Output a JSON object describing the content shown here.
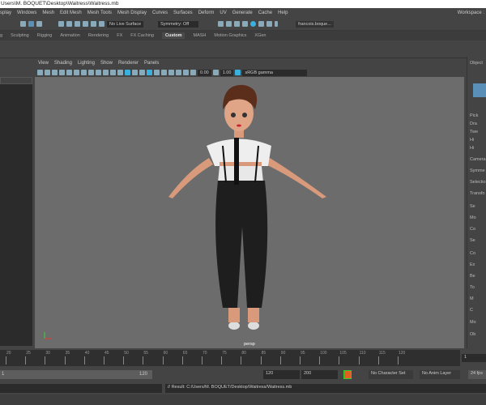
{
  "title": "Users\\M. BOQUET\\Desktop\\Waitress\\Waitress.mb",
  "menu": [
    "splay",
    "Windows",
    "Mesh",
    "Edit Mesh",
    "Mesh Tools",
    "Mesh Display",
    "Curves",
    "Surfaces",
    "Deform",
    "UV",
    "Generate",
    "Cache",
    "Help"
  ],
  "workspace": "Workspace :",
  "shelfbar": {
    "live_surface": "No Live Surface",
    "symmetry": "Symmetry: Off",
    "user": "francois.boque..."
  },
  "tabs": [
    "g",
    "Sculpting",
    "Rigging",
    "Animation",
    "Rendering",
    "FX",
    "FX Caching",
    "Custom",
    "MASH",
    "Motion Graphics",
    "XGen"
  ],
  "active_tab": "Custom",
  "viewport": {
    "menu": [
      "View",
      "Shading",
      "Lighting",
      "Show",
      "Renderer",
      "Panels"
    ],
    "exposure": "0.00",
    "gamma": "1.00",
    "colorspace": "sRGB gamma",
    "camera": "persp"
  },
  "right_panel": {
    "header": "Object",
    "items": [
      "Pick",
      "Dra",
      "Twe",
      "Hi",
      "Hi",
      "Camera",
      "Symme",
      "Selectio",
      "Transfo",
      "Se",
      "Mo",
      "Co",
      "Se",
      "Co",
      "Ex",
      "Be",
      "To",
      "M",
      "C",
      "Mo",
      "Ob"
    ]
  },
  "timeline": {
    "ticks": [
      "20",
      "25",
      "30",
      "35",
      "40",
      "45",
      "50",
      "55",
      "60",
      "65",
      "70",
      "75",
      "80",
      "85",
      "90",
      "95",
      "100",
      "105",
      "110",
      "115",
      "120"
    ],
    "current_frame": "1"
  },
  "range": {
    "start": "1",
    "end_inner": "120",
    "end": "120",
    "max": "200",
    "character_set": "No Character Set",
    "anim_layer": "No Anim Layer",
    "fps": "24 fps"
  },
  "command": {
    "result": "// Result: C:/Users/M. BOQUET/Desktop/Waitress/Waitress.mb"
  }
}
